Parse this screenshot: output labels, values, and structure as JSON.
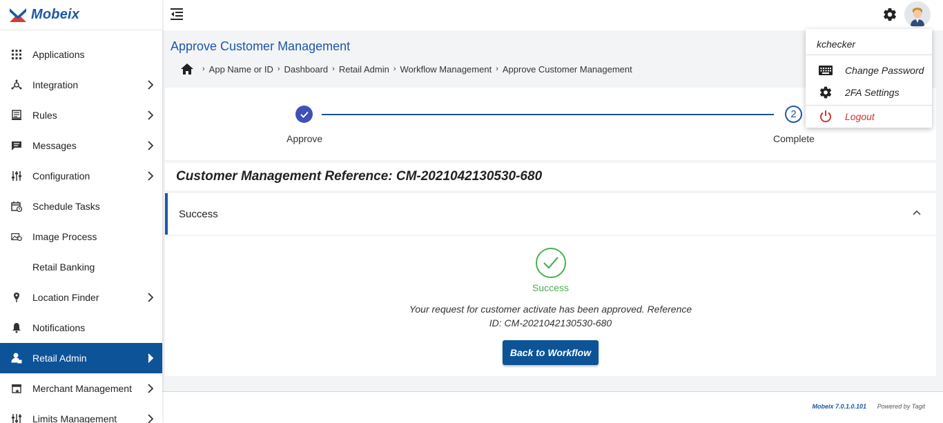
{
  "brand": {
    "name": "Mobeix"
  },
  "sidebar": {
    "items": [
      {
        "label": "Applications",
        "icon": "grid-icon",
        "has_children": false,
        "active": false
      },
      {
        "label": "Integration",
        "icon": "integration-icon",
        "has_children": true,
        "active": false
      },
      {
        "label": "Rules",
        "icon": "rules-icon",
        "has_children": true,
        "active": false
      },
      {
        "label": "Messages",
        "icon": "message-icon",
        "has_children": true,
        "active": false
      },
      {
        "label": "Configuration",
        "icon": "sliders-icon",
        "has_children": true,
        "active": false
      },
      {
        "label": "Schedule Tasks",
        "icon": "calendar-icon",
        "has_children": false,
        "active": false
      },
      {
        "label": "Image Process",
        "icon": "image-process-icon",
        "has_children": false,
        "active": false
      },
      {
        "label": "Retail Banking",
        "icon": "",
        "has_children": false,
        "active": false
      },
      {
        "label": "Location Finder",
        "icon": "location-pin-icon",
        "has_children": true,
        "active": false
      },
      {
        "label": "Notifications",
        "icon": "bell-icon",
        "has_children": false,
        "active": false
      },
      {
        "label": "Retail Admin",
        "icon": "admin-icon",
        "has_children": true,
        "active": true
      },
      {
        "label": "Merchant Management",
        "icon": "store-icon",
        "has_children": true,
        "active": false
      },
      {
        "label": "Limits Management",
        "icon": "limits-icon",
        "has_children": true,
        "active": false
      }
    ]
  },
  "page": {
    "title": "Approve Customer Management"
  },
  "breadcrumb": [
    "App Name or ID",
    "Dashboard",
    "Retail Admin",
    "Workflow Management",
    "Approve Customer Management"
  ],
  "stepper": {
    "steps": [
      {
        "label": "Approve",
        "state": "done"
      },
      {
        "label": "Complete",
        "number": "2",
        "state": "current"
      }
    ]
  },
  "reference": {
    "text": "Customer Management Reference: CM-2021042130530-680"
  },
  "accordion": {
    "title": "Success",
    "status": "Success",
    "message": "Your request for customer activate has been approved. Reference ID: CM-2021042130530-680",
    "button": "Back to Workflow"
  },
  "footer": {
    "version": "Mobeix 7.0.1.0.101",
    "powered": "Powered by Tagit"
  },
  "user_menu": {
    "username": "kchecker",
    "items": [
      {
        "label": "Change Password",
        "icon": "keyboard-icon"
      },
      {
        "label": "2FA Settings",
        "icon": "gear-icon"
      },
      {
        "label": "Logout",
        "icon": "power-icon"
      }
    ]
  },
  "colors": {
    "primary": "#0d5398",
    "accent": "#1d57a6",
    "success": "#4caf50",
    "danger": "#d32f2f",
    "step": "#3f51b5"
  }
}
